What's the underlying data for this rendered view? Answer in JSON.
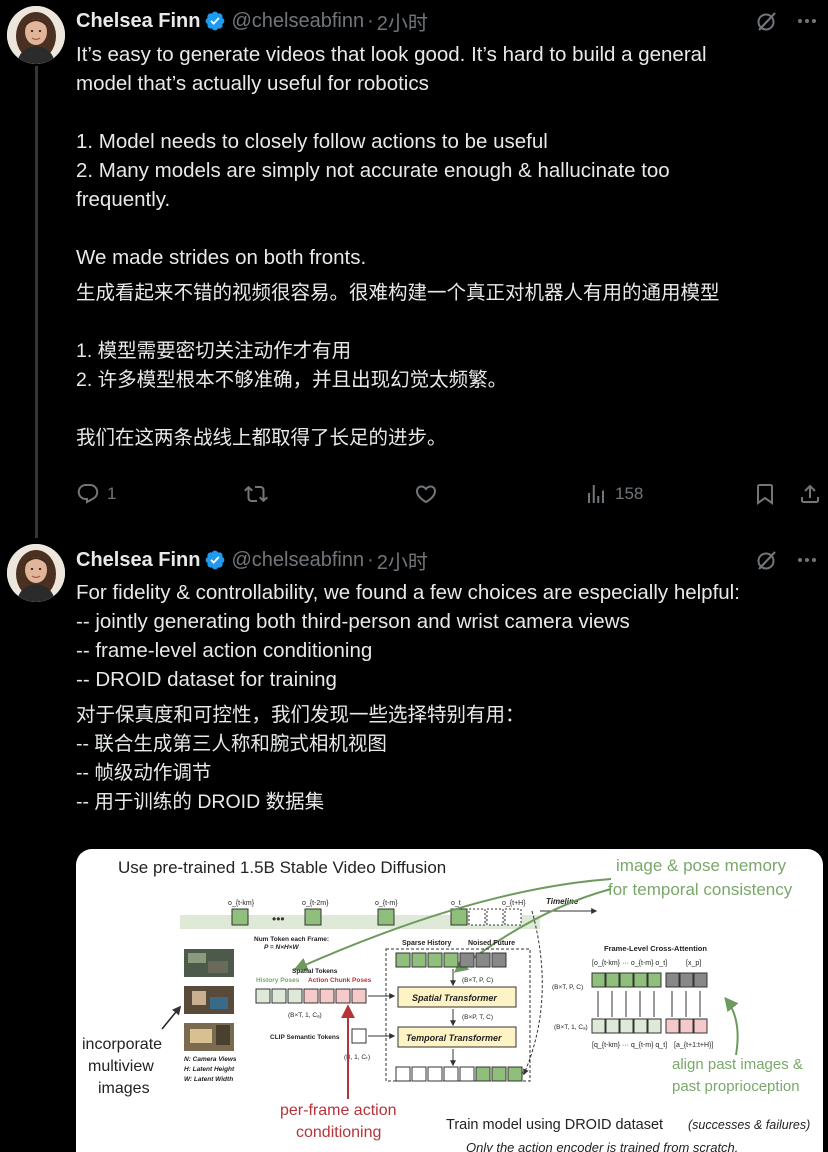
{
  "tweets": [
    {
      "author": {
        "name": "Chelsea Finn",
        "handle": "@chelseabfinn",
        "time": "2小时"
      },
      "text_en": "It’s easy to generate videos that look good. It’s hard to build a general\nmodel that’s actually useful for robotics\n\n1. Model needs to closely follow actions to be useful\n2. Many models are simply not accurate enough & hallucinate too\nfrequently.\n\nWe made strides on both fronts.",
      "text_zh": "生成看起来不错的视频很容易。很难构建一个真正对机器人有用的通用模型\n\n1. 模型需要密切关注动作才有用\n2. 许多模型根本不够准确，并且出现幻觉太频繁。\n\n我们在这两条战线上都取得了长足的进步。",
      "replies": "1",
      "views": "158",
      "icons": [
        "grok-icon",
        "more-icon",
        "reply-icon",
        "retweet-icon",
        "like-icon",
        "views-icon",
        "bookmark-icon",
        "share-icon"
      ]
    },
    {
      "author": {
        "name": "Chelsea Finn",
        "handle": "@chelseabfinn",
        "time": "2小时"
      },
      "text_en": "For fidelity & controllability, we found a few choices are especially helpful:\n-- jointly generating both third-person and wrist camera views\n-- frame-level action conditioning\n-- DROID dataset for training",
      "text_zh": "对于保真度和可控性，我们发现一些选择特别有用：\n-- 联合生成第三人称和腕式相机视图\n-- 帧级动作调节\n-- 用于训练的 DROID 数据集"
    }
  ],
  "figure": {
    "title": "Use pre-trained 1.5B Stable Video Diffusion",
    "memory_note_1": "image & pose memory",
    "memory_note_2": "for temporal consistency",
    "timeline": "Timeline",
    "tok_labels": [
      "o_{t-km}",
      "o_{t-2m}",
      "o_{t-m}",
      "o_t",
      "o_{t+H}"
    ],
    "num_token": "Num Token each Frame:",
    "num_token_eq": "P = N×H×W",
    "spatial_tokens": "Spatial Tokens",
    "history_poses": "History Poses",
    "action_chunk": "Action Chunk Poses",
    "sparse_history": "Sparse History",
    "noised_future": "Noised Future",
    "btpc": "(B×T, P, C)",
    "spatial_transformer": "Spatial Transformer",
    "bptc": "(B×P, T, C)",
    "temporal_transformer": "Temporal Transformer",
    "xn": "×N",
    "bt1c": "(B×T, 1, Cₐ)",
    "clip_tokens": "CLIP Semantic Tokens",
    "b1c": "(B, 1, Cₜ)",
    "legend_n": "N: Camera Views",
    "legend_h": "H: Latent Height",
    "legend_w": "W: Latent Width",
    "incorporate_1": "incorporate",
    "incorporate_2": "multiview",
    "incorporate_3": "images",
    "per_frame_1": "per-frame action",
    "per_frame_2": "conditioning",
    "cross_attention": "Frame-Level Cross-Attention",
    "ca_top": "[o_{t-km} ··· o_{t-m} o_t]",
    "ca_x": "[x_p]",
    "ca_bot": "[q_{t-km} ··· q_{t-m} q_t]",
    "ca_a": "[a_{t+1:t+H}]",
    "align_1": "align past images &",
    "align_2": "past proprioception",
    "train_note": "Train model using DROID dataset",
    "train_note_sub": "(successes & failures)",
    "scratch_note": "Only the action encoder is trained from scratch."
  },
  "colors": {
    "accent": "#1d9bf0",
    "green": "#7aa86a",
    "red": "#b5343a"
  }
}
